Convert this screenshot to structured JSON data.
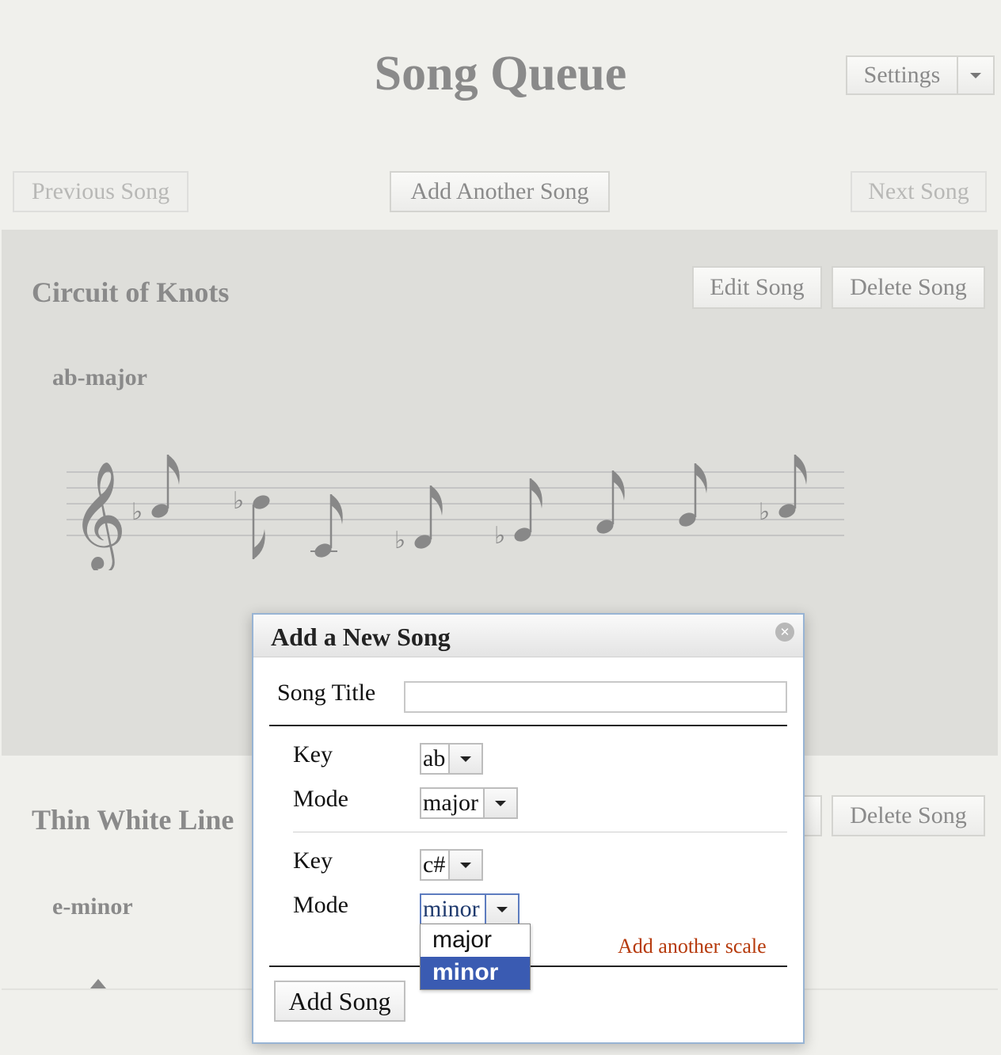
{
  "header": {
    "title": "Song Queue",
    "settings_label": "Settings"
  },
  "nav": {
    "previous_label": "Previous Song",
    "add_another_label": "Add Another Song",
    "next_label": "Next Song"
  },
  "songs": [
    {
      "title": "Circuit of Knots",
      "edit_label": "Edit Song",
      "delete_label": "Delete Song",
      "scale": "ab-major"
    },
    {
      "title": "Thin White Line",
      "delete_label": "Delete Song",
      "scale": "e-minor"
    }
  ],
  "modal": {
    "title": "Add a New Song",
    "song_title_label": "Song Title",
    "song_title_value": "",
    "scales": [
      {
        "key_label": "Key",
        "key_value": "ab",
        "mode_label": "Mode",
        "mode_value": "major"
      },
      {
        "key_label": "Key",
        "key_value": "c#",
        "mode_label": "Mode",
        "mode_value": "minor"
      }
    ],
    "mode_options": [
      "major",
      "minor"
    ],
    "selected_option": "minor",
    "add_scale_label": "Add another scale",
    "add_song_label": "Add Song"
  },
  "colors": {
    "dropdown_highlight": "#3a5bb2",
    "link_accent": "#b63a0c",
    "modal_border": "#98b4d4"
  }
}
